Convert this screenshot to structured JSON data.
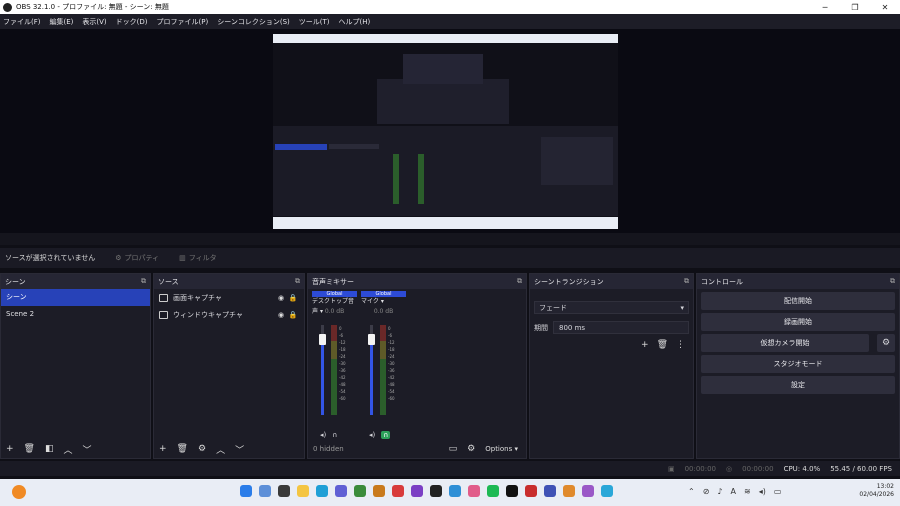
{
  "window": {
    "title": "OBS 32.1.0 - プロファイル: 無題 - シーン: 無題"
  },
  "menu": [
    "ファイル(F)",
    "編集(E)",
    "表示(V)",
    "ドック(D)",
    "プロファイル(P)",
    "シーンコレクション(S)",
    "ツール(T)",
    "ヘルプ(H)"
  ],
  "context_bar": {
    "no_selection": "ソースが選択されていません",
    "properties": "プロパティ",
    "filters": "フィルタ"
  },
  "scenes": {
    "title": "シーン",
    "items": [
      "シーン",
      "Scene 2"
    ]
  },
  "sources": {
    "title": "ソース",
    "items": [
      "画面キャプチャ",
      "ウィンドウキャプチャ"
    ]
  },
  "mixer": {
    "title": "音声ミキサー",
    "channels": [
      {
        "global": "Global",
        "name": "デスクトップ音声",
        "db": "0.0 dB",
        "level": 0.85
      },
      {
        "global": "Global",
        "name": "マイク",
        "db": "0.0 dB",
        "level": 0.85
      }
    ],
    "scale": [
      "0",
      "-6",
      "-12",
      "-18",
      "-24",
      "-30",
      "-36",
      "-42",
      "-48",
      "-54",
      "-60"
    ],
    "hidden": "0 hidden",
    "options": "Options"
  },
  "transitions": {
    "title": "シーントランジション",
    "selected": "フェード",
    "duration_label": "期間",
    "duration": "800 ms"
  },
  "controls": {
    "title": "コントロール",
    "buttons": {
      "stream": "配信開始",
      "record": "録画開始",
      "vcam": "仮想カメラ開始",
      "studio": "スタジオモード",
      "settings": "設定"
    }
  },
  "status": {
    "rec_time": "00:00:00",
    "stream_time": "00:00:00",
    "cpu": "CPU: 4.0%",
    "fps": "55.45 / 60.00 FPS"
  },
  "taskbar": {
    "time": "13:02",
    "date": "02/04/2026"
  },
  "colors": {
    "accent": "#2742b8",
    "background": "#1c1c26"
  }
}
